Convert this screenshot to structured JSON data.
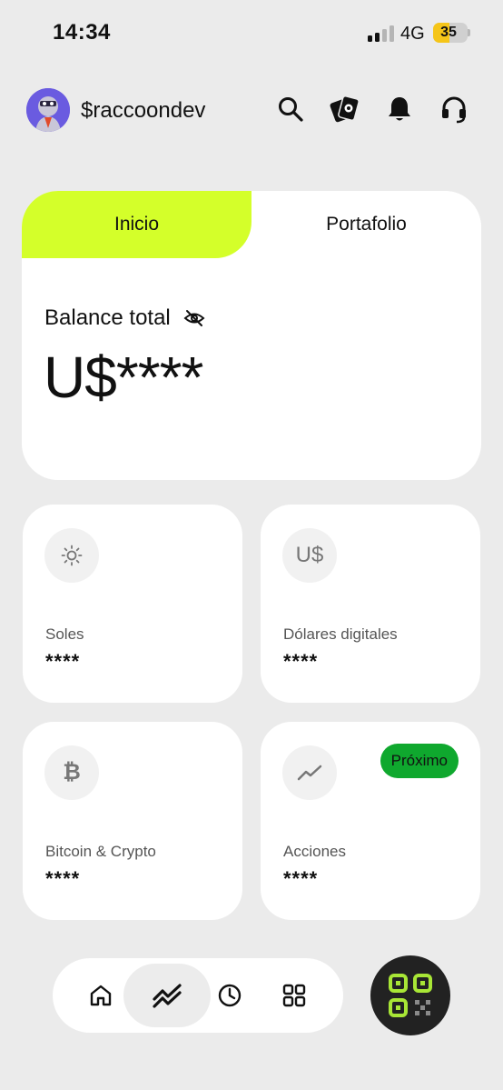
{
  "status_bar": {
    "time": "14:34",
    "network": "4G",
    "battery": "35",
    "battery_level_percent": 35,
    "signal_bars_active": 2,
    "signal_bars_total": 4
  },
  "header": {
    "username": "$raccoondev",
    "icons": [
      "search-icon",
      "cards-icon",
      "bell-icon",
      "headset-icon"
    ]
  },
  "balance_card": {
    "tabs": [
      {
        "label": "Inicio",
        "active": true
      },
      {
        "label": "Portafolio",
        "active": false
      }
    ],
    "label": "Balance total",
    "value": "U$****",
    "visibility_icon": "eye-off-icon"
  },
  "tiles": [
    {
      "label": "Soles",
      "value": "****",
      "icon": "sun-icon"
    },
    {
      "label": "Dólares digitales",
      "value": "****",
      "icon_text": "U$"
    },
    {
      "label": "Bitcoin & Crypto",
      "value": "****",
      "icon_text": "₿"
    },
    {
      "label": "Acciones",
      "value": "****",
      "icon": "trend-icon",
      "badge": "Próximo"
    }
  ],
  "bottom_nav": {
    "items": [
      "home-icon",
      "trend-icon",
      "clock-icon",
      "grid-icon"
    ],
    "active_index": 1
  },
  "qr_button": {
    "icon": "qr-scan-icon"
  },
  "colors": {
    "background": "#ebebeb",
    "accent_lime": "#d4ff2a",
    "badge_green": "#0fa82e",
    "qr_dark": "#222222",
    "qr_green": "#a8e636",
    "battery_yellow": "#f5c518"
  }
}
